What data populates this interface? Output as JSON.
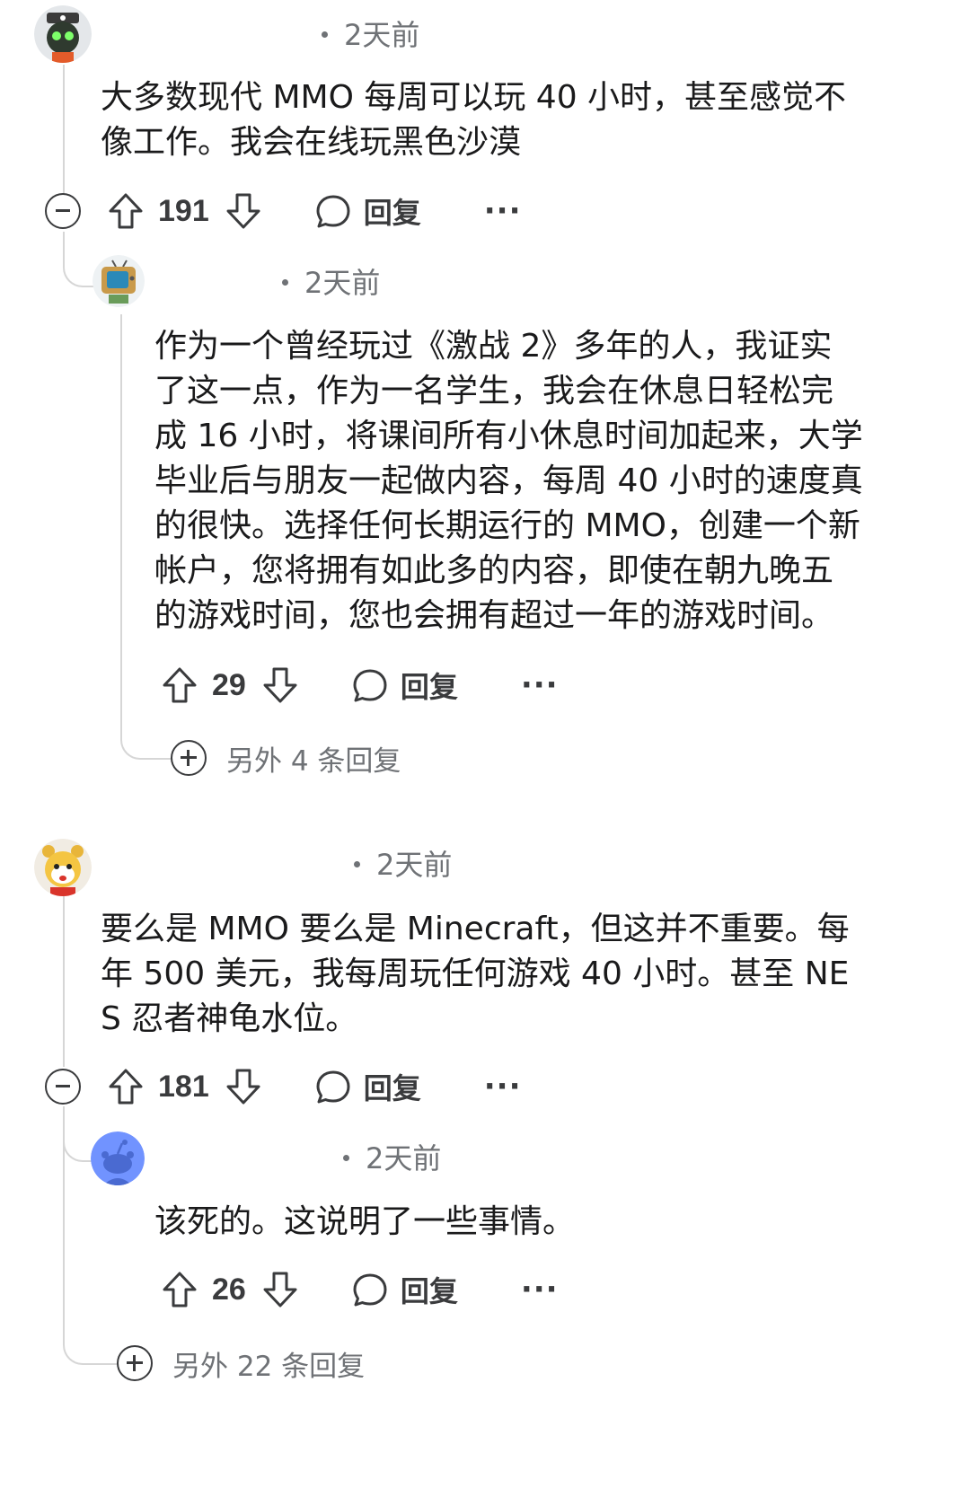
{
  "comments": [
    {
      "time": "2天前",
      "body": "大多数现代 MMO 每周可以玩 40 小时，甚至感觉不像工作。我会在线玩黑色沙漠",
      "votes": "191",
      "reply_label": "回复",
      "more_label": "···",
      "replies": [
        {
          "time": "2天前",
          "body": "作为一个曾经玩过《激战 2》多年的人，我证实了这一点，作为一名学生，我会在休息日轻松完成 16 小时，将课间所有小休息时间加起来，大学毕业后与朋友一起做内容，每周 40 小时的速度真的很快。选择任何长期运行的 MMO，创建一个新帐户，您将拥有如此多的内容，即使在朝九晚五的游戏时间，您也会拥有超过一年的游戏时间。",
          "votes": "29",
          "reply_label": "回复",
          "more_label": "···"
        }
      ],
      "more_replies": "另外 4 条回复"
    },
    {
      "time": "2天前",
      "body": "要么是 MMO 要么是 Minecraft，但这并不重要。每年 500 美元，我每周玩任何游戏 40 小时。甚至 NES 忍者神龟水位。",
      "votes": "181",
      "reply_label": "回复",
      "more_label": "···",
      "replies": [
        {
          "time": "2天前",
          "body": "该死的。这说明了一些事情。",
          "votes": "26",
          "reply_label": "回复",
          "more_label": "···"
        }
      ],
      "more_replies": "另外 22 条回复"
    }
  ],
  "colors": {
    "text": "#1a1a1b",
    "meta": "#6f7276",
    "icon": "#3a3b3d",
    "thread_line": "#d6d6d6",
    "default_avatar": "#7193ff"
  }
}
